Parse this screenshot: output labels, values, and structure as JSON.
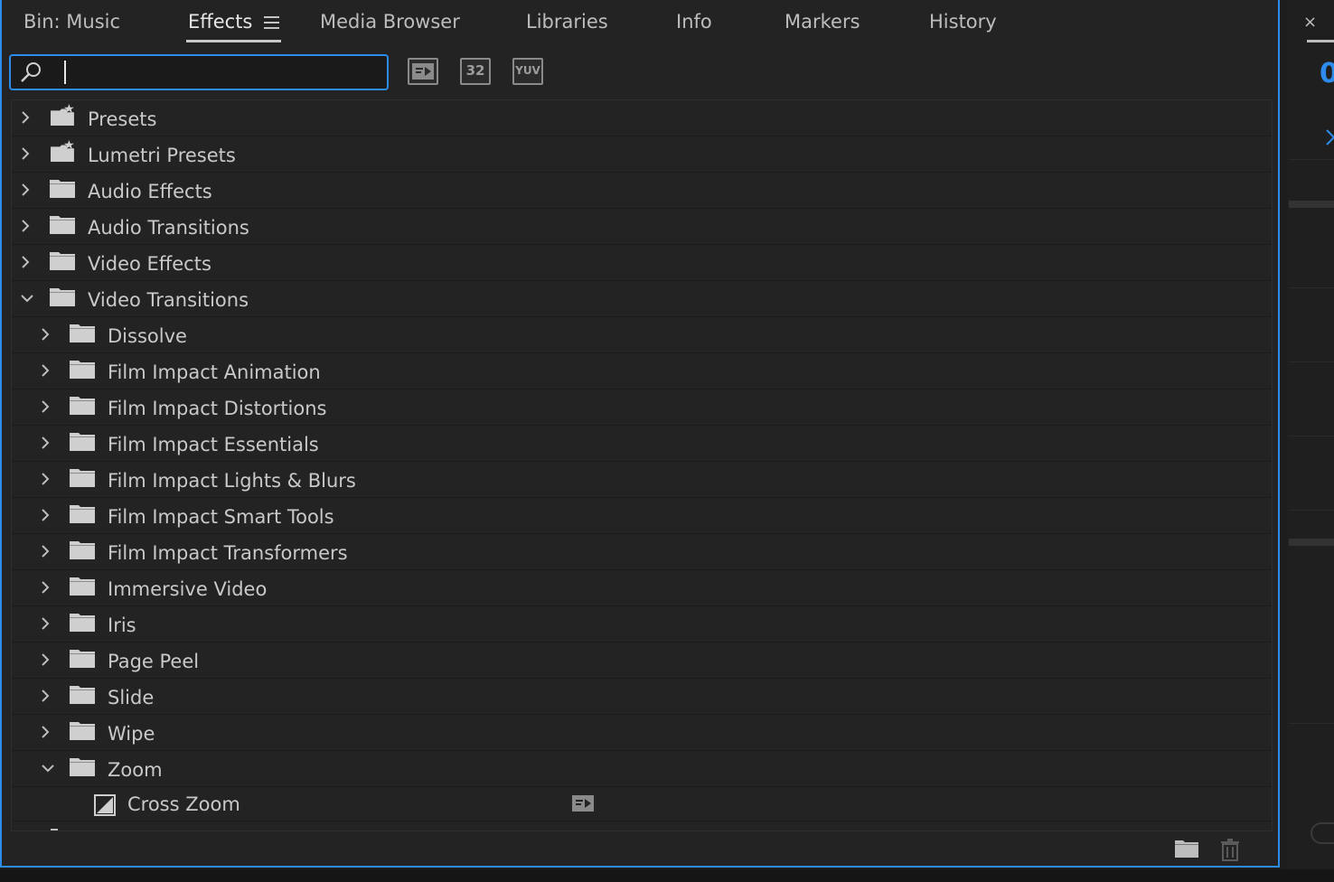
{
  "tabs": [
    {
      "label": "Bin: Music"
    },
    {
      "label": "Effects"
    },
    {
      "label": "Media Browser"
    },
    {
      "label": "Libraries"
    },
    {
      "label": "Info"
    },
    {
      "label": "Markers"
    },
    {
      "label": "History"
    }
  ],
  "search": {
    "value": "",
    "placeholder": ""
  },
  "toolbar": {
    "accelerated_icon": "accelerated-effects-icon",
    "bit_label": "32",
    "yuv_label": "YUV"
  },
  "tree": [
    {
      "label": "Presets",
      "icon": "preset-folder-icon",
      "expanded": false
    },
    {
      "label": "Lumetri Presets",
      "icon": "preset-folder-icon",
      "expanded": false
    },
    {
      "label": "Audio Effects",
      "icon": "folder-icon",
      "expanded": false
    },
    {
      "label": "Audio Transitions",
      "icon": "folder-icon",
      "expanded": false
    },
    {
      "label": "Video Effects",
      "icon": "folder-icon",
      "expanded": false
    },
    {
      "label": "Video Transitions",
      "icon": "folder-icon",
      "expanded": true
    },
    {
      "label": "Dissolve",
      "icon": "folder-icon",
      "expanded": false
    },
    {
      "label": "Film Impact Animation",
      "icon": "folder-icon",
      "expanded": false
    },
    {
      "label": "Film Impact Distortions",
      "icon": "folder-icon",
      "expanded": false
    },
    {
      "label": "Film Impact Essentials",
      "icon": "folder-icon",
      "expanded": false
    },
    {
      "label": "Film Impact Lights & Blurs",
      "icon": "folder-icon",
      "expanded": false
    },
    {
      "label": "Film Impact Smart Tools",
      "icon": "folder-icon",
      "expanded": false
    },
    {
      "label": "Film Impact Transformers",
      "icon": "folder-icon",
      "expanded": false
    },
    {
      "label": "Immersive Video",
      "icon": "folder-icon",
      "expanded": false
    },
    {
      "label": "Iris",
      "icon": "folder-icon",
      "expanded": false
    },
    {
      "label": "Page Peel",
      "icon": "folder-icon",
      "expanded": false
    },
    {
      "label": "Slide",
      "icon": "folder-icon",
      "expanded": false
    },
    {
      "label": "Wipe",
      "icon": "folder-icon",
      "expanded": false
    },
    {
      "label": "Zoom",
      "icon": "folder-icon",
      "expanded": true
    },
    {
      "label": "Cross Zoom",
      "icon": "transition-icon",
      "badge": "accelerated-effects-icon"
    }
  ],
  "footer": {
    "new_folder_icon": "new-bin-icon",
    "delete_icon": "trash-icon"
  },
  "side_panel": {
    "close_label": "×",
    "value_fragment": "0"
  },
  "colors": {
    "accent": "#2d8ceb",
    "panel_bg": "#232323",
    "text": "#c9c9c9"
  }
}
